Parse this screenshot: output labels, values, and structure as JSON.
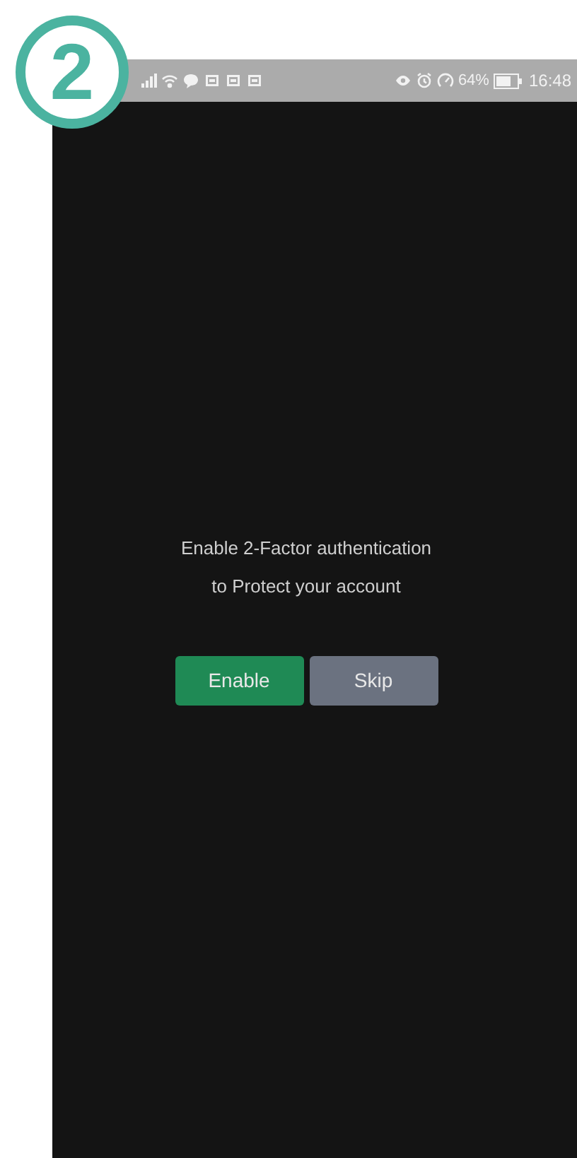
{
  "step_badge": "2",
  "status_bar": {
    "battery_percent": "64%",
    "time": "16:48"
  },
  "prompt": {
    "lines": [
      "Enable 2-Factor authentication",
      "to Protect your account"
    ]
  },
  "buttons": [
    {
      "label": "Enable",
      "kind": "primary"
    },
    {
      "label": "Skip",
      "kind": "secondary"
    }
  ]
}
